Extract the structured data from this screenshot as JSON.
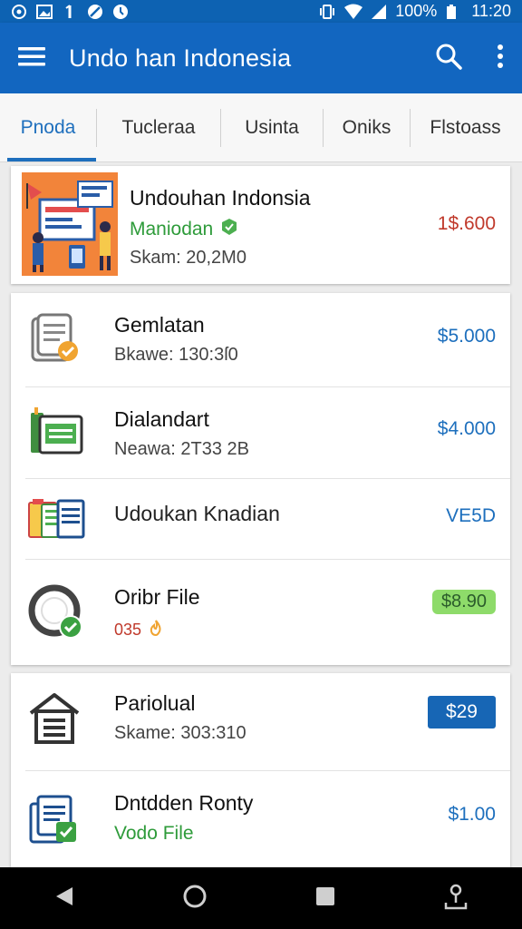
{
  "status": {
    "battery": "100%",
    "time": "11:20"
  },
  "appbar": {
    "title": "Undo han Indonesia"
  },
  "tabs": [
    "Pnoda",
    "Tucleraa",
    "Usinta",
    "Oniks",
    "Flstoass"
  ],
  "featured": {
    "title": "Undouhan Indonsia",
    "subtitle": "Maniodan",
    "meta": "Skam: 20,2M0",
    "price": "1$.600"
  },
  "list1": [
    {
      "title": "Gemlatan",
      "sub": "Bkawe: 130:3ſ0",
      "price": "$5.000"
    },
    {
      "title": "Dialandart",
      "sub": "Neawa: 2T33 2B",
      "price": "$4.000"
    },
    {
      "title": "Udoukan Knadian",
      "sub": "",
      "price": "VE5D"
    },
    {
      "title": "Oribr File",
      "sub": "035",
      "price": "$8.90"
    }
  ],
  "list2": [
    {
      "title": "Pariolual",
      "sub": "Skame: 303:310",
      "price": "$29"
    },
    {
      "title": "Dntdden Ronty",
      "sub": "Vodo File",
      "price": "$1.00"
    }
  ],
  "colors": {
    "primary": "#1266c0",
    "price_blue": "#1d6fbd",
    "price_red": "#c0392b",
    "green": "#2e9b3a",
    "badge_green": "#8edb6a",
    "badge_blue": "#1766b5"
  }
}
